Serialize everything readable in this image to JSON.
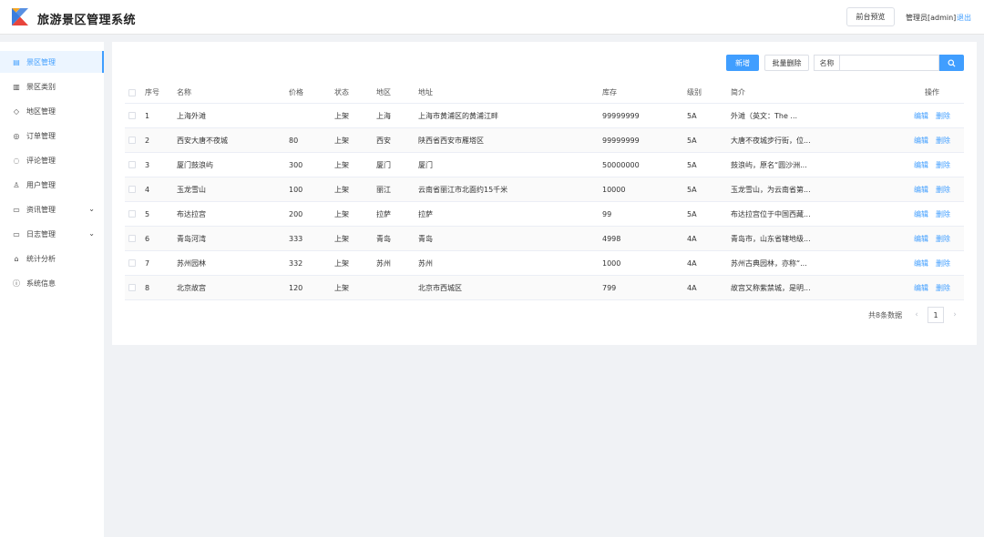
{
  "header": {
    "app_title": "旅游景区管理系统",
    "preview_label": "前台预览",
    "user_text": "管理员[admin]",
    "logout_label": "退出",
    "logo_colors": [
      "#3b7ddd",
      "#f5a623",
      "#e8453c"
    ]
  },
  "sidebar": {
    "items": [
      {
        "label": "景区管理",
        "icon": "document-icon",
        "glyph": "▤",
        "active": true,
        "arrow": false
      },
      {
        "label": "景区类别",
        "icon": "grid-icon",
        "glyph": "▥",
        "active": false,
        "arrow": false
      },
      {
        "label": "地区管理",
        "icon": "tag-icon",
        "glyph": "◇",
        "active": false,
        "arrow": false
      },
      {
        "label": "订单管理",
        "icon": "coin-icon",
        "glyph": "◎",
        "active": false,
        "arrow": false
      },
      {
        "label": "评论管理",
        "icon": "chat-icon",
        "glyph": "◌",
        "active": false,
        "arrow": false
      },
      {
        "label": "用户管理",
        "icon": "user-icon",
        "glyph": "♙",
        "active": false,
        "arrow": false
      },
      {
        "label": "资讯管理",
        "icon": "folder-icon",
        "glyph": "▭",
        "active": false,
        "arrow": true
      },
      {
        "label": "日志管理",
        "icon": "folder-icon",
        "glyph": "▭",
        "active": false,
        "arrow": true
      },
      {
        "label": "统计分析",
        "icon": "home-icon",
        "glyph": "⌂",
        "active": false,
        "arrow": false
      },
      {
        "label": "系统信息",
        "icon": "info-icon",
        "glyph": "ⓘ",
        "active": false,
        "arrow": false
      }
    ],
    "arrow_glyph": "⌄"
  },
  "toolbar": {
    "add_label": "新增",
    "batch_delete_label": "批量删除",
    "search_label": "名称",
    "search_value": "",
    "search_placeholder": ""
  },
  "table": {
    "headers": [
      "序号",
      "名称",
      "价格",
      "状态",
      "地区",
      "地址",
      "库存",
      "级别",
      "简介",
      "操作"
    ],
    "edit_label": "编辑",
    "delete_label": "删除",
    "rows": [
      {
        "no": "1",
        "name": "上海外滩",
        "price": "",
        "status": "上架",
        "region": "上海",
        "address": "上海市黄浦区的黄浦江畔",
        "stock": "99999999",
        "level": "5A",
        "intro": "外滩（英文：The ..."
      },
      {
        "no": "2",
        "name": "西安大唐不夜城",
        "price": "80",
        "status": "上架",
        "region": "西安",
        "address": "陕西省西安市雁塔区",
        "stock": "99999999",
        "level": "5A",
        "intro": "大唐不夜城步行街，位..."
      },
      {
        "no": "3",
        "name": "厦门鼓浪屿",
        "price": "300",
        "status": "上架",
        "region": "厦门",
        "address": "厦门",
        "stock": "50000000",
        "level": "5A",
        "intro": "鼓浪屿，原名“圆沙洲..."
      },
      {
        "no": "4",
        "name": "玉龙雪山",
        "price": "100",
        "status": "上架",
        "region": "丽江",
        "address": "云南省丽江市北面约15千米",
        "stock": "10000",
        "level": "5A",
        "intro": "玉龙雪山，为云南省第..."
      },
      {
        "no": "5",
        "name": "布达拉宫",
        "price": "200",
        "status": "上架",
        "region": "拉萨",
        "address": "拉萨",
        "stock": "99",
        "level": "5A",
        "intro": "布达拉宫位于中国西藏..."
      },
      {
        "no": "6",
        "name": "青岛河湾",
        "price": "333",
        "status": "上架",
        "region": "青岛",
        "address": "青岛",
        "stock": "4998",
        "level": "4A",
        "intro": "青岛市，山东省辖地级..."
      },
      {
        "no": "7",
        "name": "苏州园林",
        "price": "332",
        "status": "上架",
        "region": "苏州",
        "address": "苏州",
        "stock": "1000",
        "level": "4A",
        "intro": "苏州古典园林，亦称“..."
      },
      {
        "no": "8",
        "name": "北京故宫",
        "price": "120",
        "status": "上架",
        "region": "",
        "address": "北京市西城区",
        "stock": "799",
        "level": "4A",
        "intro": "故宫又称紫禁城，是明..."
      }
    ]
  },
  "pagination": {
    "total_text": "共8条数据",
    "prev_glyph": "‹",
    "next_glyph": "›",
    "current_page": "1"
  },
  "colors": {
    "accent": "#409eff",
    "active_bg": "#ecf5ff",
    "page_bg": "#f0f2f5"
  }
}
